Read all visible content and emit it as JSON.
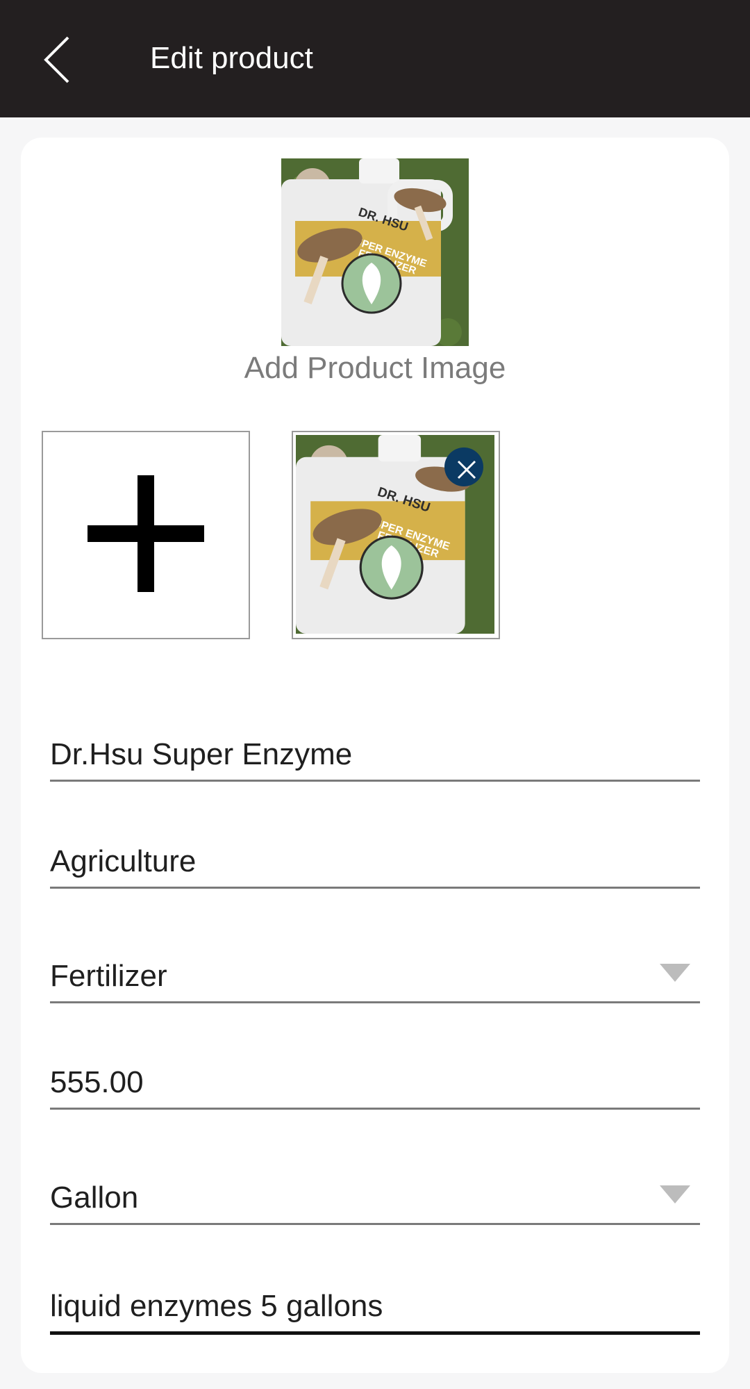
{
  "header": {
    "title": "Edit product",
    "back_icon": "chevron-left-icon"
  },
  "image_section": {
    "add_label": "Add Product Image",
    "add_icon": "plus-icon",
    "remove_icon": "close-icon",
    "product_label_lines": [
      "DR. HSU",
      "SUPER ENZYME",
      "FERTILIZER"
    ]
  },
  "form": {
    "product_name": "Dr.Hsu Super Enzyme",
    "category": "Agriculture",
    "subcategory": "Fertilizer",
    "price": "555.00",
    "unit": "Gallon",
    "description": "liquid enzymes 5 gallons"
  },
  "colors": {
    "header_bg": "#231f20",
    "remove_button": "#0b3a63",
    "background": "#f6f6f7"
  }
}
